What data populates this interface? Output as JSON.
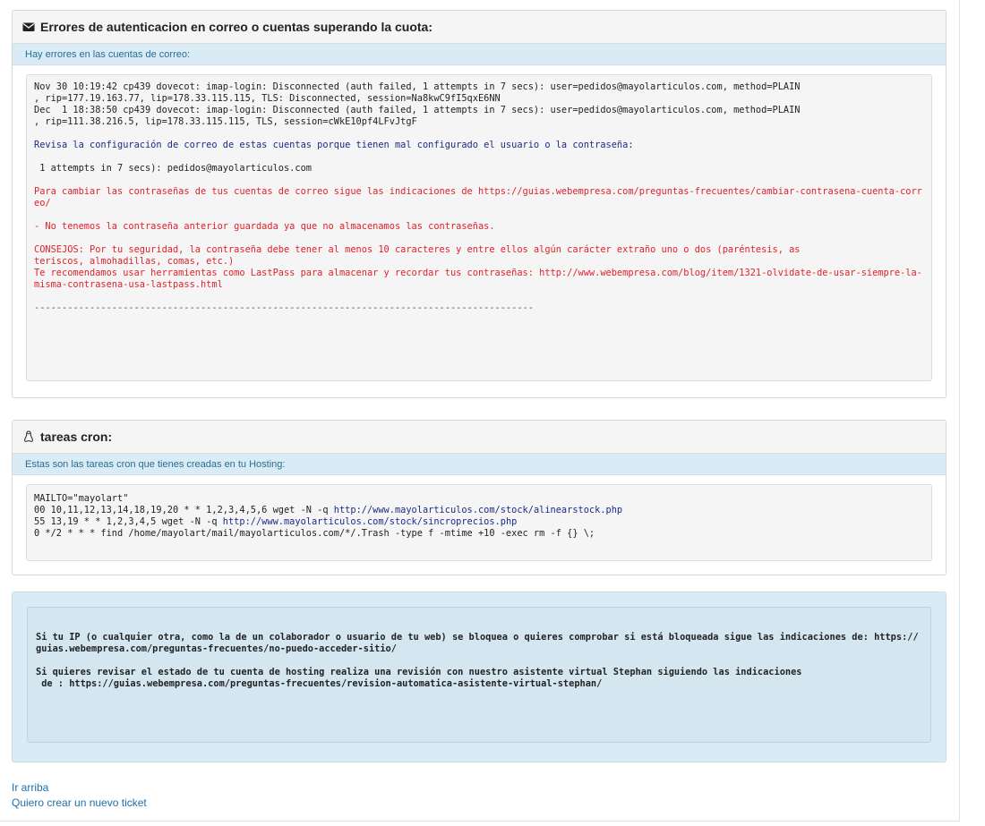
{
  "panel1": {
    "title": "Errores de autenticacion en correo o cuentas superando la cuota:",
    "subtitle": "Hay errores en las cuentas de correo:",
    "log_lines": [
      "Nov 30 10:19:42 cp439 dovecot: imap-login: Disconnected (auth failed, 1 attempts in 7 secs): user=pedidos@mayolarticulos.com, method=PLAIN\n, rip=177.19.163.77, lip=178.33.115.115, TLS: Disconnected, session=Na8kwC9fI5qxE6NN",
      "Dec  1 18:38:50 cp439 dovecot: imap-login: Disconnected (auth failed, 1 attempts in 7 secs): user=pedidos@mayolarticulos.com, method=PLAIN\n, rip=111.38.216.5, lip=178.33.115.115, TLS, session=cWkE10pf4LFvJtgF"
    ],
    "review_msg": "Revisa la configuración de correo de estas cuentas porque tienen mal configurado el usuario o la contraseña:",
    "account_line": " 1 attempts in 7 secs): pedidos@mayolarticulos.com",
    "change_pw_msg": "Para cambiar las contraseñas de tus cuentas de correo sigue las indicaciones de https://guias.webempresa.com/preguntas-frecuentes/cambiar-contrasena-cuenta-correo/",
    "no_stored_msg": "- No tenemos la contraseña anterior guardada ya que no almacenamos las contraseñas.",
    "advice_msg": "CONSEJOS: Por tu seguridad, la contraseña debe tener al menos 10 caracteres y entre ellos algún carácter extraño uno o dos (paréntesis, as\nteriscos, almohadillas, comas, etc.)",
    "lastpass_msg": "Te recomendamos usar herramientas como LastPass para almacenar y recordar tus contraseñas: http://www.webempresa.com/blog/item/1321-olvidate-de-usar-siempre-la-misma-contrasena-usa-lastpass.html",
    "separator": "------------------------------------------------------------------------------------------"
  },
  "panel2": {
    "title": "tareas cron:",
    "subtitle": "Estas son las tareas cron que tienes creadas en tu Hosting:",
    "mailto": "MAILTO=\"mayolart\"",
    "cron1_prefix": "00 10,11,12,13,14,18,19,20 * * 1,2,3,4,5,6 wget -N -q ",
    "cron1_link": "http://www.mayolarticulos.com/stock/alinearstock.php",
    "cron2_prefix": "55 13,19 * * 1,2,3,4,5 wget -N -q ",
    "cron2_link": "http://www.mayolarticulos.com/stock/sincroprecios.php",
    "cron3": "0 */2 * * * find /home/mayolart/mail/mayolarticulos.com/*/.Trash -type f -mtime +10 -exec rm -f {} \\;"
  },
  "info": {
    "ip_msg": "Si tu IP (o cualquier otra, como la de un colaborador o usuario de tu web) se bloquea o quieres comprobar si está bloqueada sigue las indicaciones de: https://guias.webempresa.com/preguntas-frecuentes/no-puedo-acceder-sitio/",
    "stephan_msg": "Si quieres revisar el estado de tu cuenta de hosting realiza una revisión con nuestro asistente virtual Stephan siguiendo las indicaciones\n de : https://guias.webempresa.com/preguntas-frecuentes/revision-automatica-asistente-virtual-stephan/"
  },
  "footer": {
    "top_link": "Ir arriba",
    "ticket_link": "Quiero crear un nuevo ticket"
  },
  "colors": {
    "link": "#1b6fae",
    "subheader_bg": "#d9ecf5",
    "warning_red": "#e0222a",
    "notice_blue": "#1a2b8a"
  },
  "icons": {
    "panel1": "envelope-icon",
    "panel2": "linux-tux-icon"
  }
}
